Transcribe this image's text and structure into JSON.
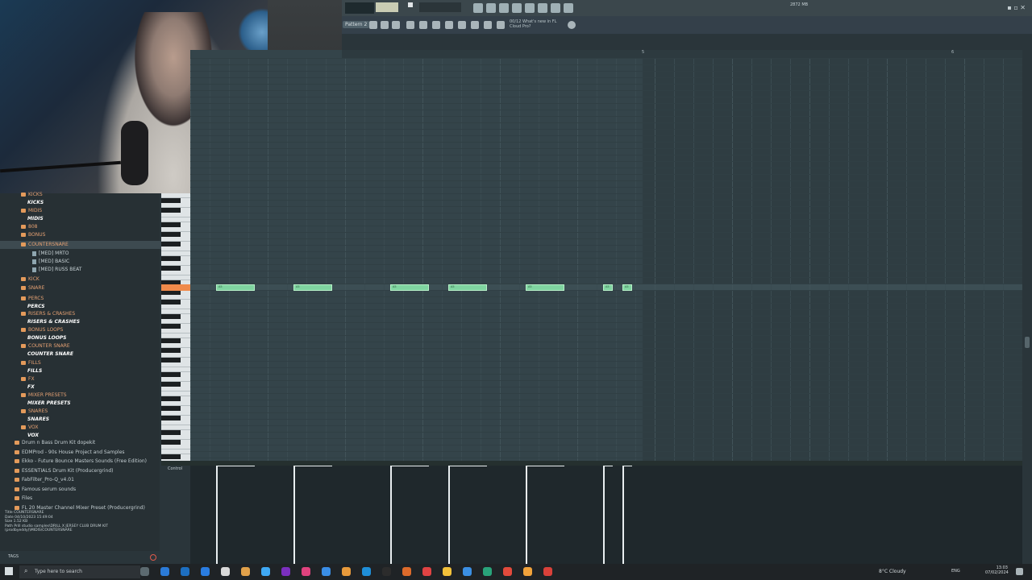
{
  "topbar": {
    "memory": "2872 MB",
    "pattern": "Pattern 2",
    "hint_line1": "00/12  What's new in FL",
    "hint_line2": "Cloud Pro?"
  },
  "browser": {
    "items": [
      {
        "label": "KICKS",
        "type": "folder"
      },
      {
        "label": "KICKS",
        "type": "sub"
      },
      {
        "label": "MIDIS",
        "type": "folder"
      },
      {
        "label": "MIDIS",
        "type": "sub"
      },
      {
        "label": "808",
        "type": "folder"
      },
      {
        "label": "BONUS",
        "type": "folder"
      },
      {
        "label": "COUNTERSNARE",
        "type": "folder"
      },
      {
        "label": "[MED] MRTO",
        "type": "file"
      },
      {
        "label": "[MED] BASIC",
        "type": "file"
      },
      {
        "label": "[MED] RUSS BEAT",
        "type": "file"
      },
      {
        "label": "KICK",
        "type": "folder"
      },
      {
        "label": "SNARE",
        "type": "folder"
      },
      {
        "label": "PERCS",
        "type": "folder"
      },
      {
        "label": "PERCS",
        "type": "sub"
      },
      {
        "label": "RISERS & CRASHES",
        "type": "folder"
      },
      {
        "label": "RISERS & CRASHES",
        "type": "sub"
      },
      {
        "label": "BONUS LOOPS",
        "type": "folder"
      },
      {
        "label": "BONUS LOOPS",
        "type": "sub"
      },
      {
        "label": "COUNTER SNARE",
        "type": "folder"
      },
      {
        "label": "COUNTER SNARE",
        "type": "sub"
      },
      {
        "label": "FILLS",
        "type": "folder"
      },
      {
        "label": "FILLS",
        "type": "sub"
      },
      {
        "label": "FX",
        "type": "folder"
      },
      {
        "label": "FX",
        "type": "sub"
      },
      {
        "label": "MIXER PRESETS",
        "type": "folder"
      },
      {
        "label": "MIXER PRESETS",
        "type": "sub"
      },
      {
        "label": "SNARES",
        "type": "folder"
      },
      {
        "label": "SNARES",
        "type": "sub"
      },
      {
        "label": "VOX",
        "type": "folder"
      },
      {
        "label": "VOX",
        "type": "sub"
      },
      {
        "label": "Drum n Bass Drum Kit dopekit",
        "type": "plain"
      },
      {
        "label": "EDMProd - 90s House Project and Samples",
        "type": "plain"
      },
      {
        "label": "Ekko - Future Bounce Masters Sounds (Free Edition)",
        "type": "plain"
      },
      {
        "label": "ESSENTIALS Drum Kit (Producergrind)",
        "type": "plain"
      },
      {
        "label": "FabFilter_Pro-Q_v4.01",
        "type": "plain"
      },
      {
        "label": "Famous serum sounds",
        "type": "plain"
      },
      {
        "label": "Files",
        "type": "plain"
      },
      {
        "label": "FL 20 Master Channel Mixer Preset (Producergrind)",
        "type": "plain"
      }
    ],
    "info": {
      "title": "Title  COUNTERSNARE",
      "date": "Date   04/10/2023 15:49:04",
      "size": "Size   1.52 KB",
      "path": "Path   Prill studio samples\\DRILL X JERSEY CLUB DRUM KIT (prodbyeddy)\\MIDIS\\COUNTERSNARE"
    },
    "tags": "TAGS"
  },
  "roll": {
    "ruler": [
      "5",
      "6"
    ],
    "control_label": "Control",
    "notes": [
      {
        "start": 0.0,
        "len": 1.0,
        "label": "A5"
      },
      {
        "start": 2.0,
        "len": 1.0,
        "label": "A5"
      },
      {
        "start": 4.5,
        "len": 1.0,
        "label": "A5"
      },
      {
        "start": 6.0,
        "len": 1.0,
        "label": "A5"
      },
      {
        "start": 8.0,
        "len": 1.0,
        "label": "A5"
      },
      {
        "start": 10.0,
        "len": 0.25,
        "label": "A5"
      },
      {
        "start": 10.5,
        "len": 0.25,
        "label": "A5"
      }
    ]
  },
  "taskbar": {
    "search_placeholder": "Type here to search",
    "weather": "8°C  Cloudy",
    "lang": "ENG",
    "time": "13:03",
    "date": "07/02/2024"
  },
  "colors": {
    "note": "#7fd4a0",
    "active_key": "#f08a4b",
    "folder": "#e39a5b"
  }
}
